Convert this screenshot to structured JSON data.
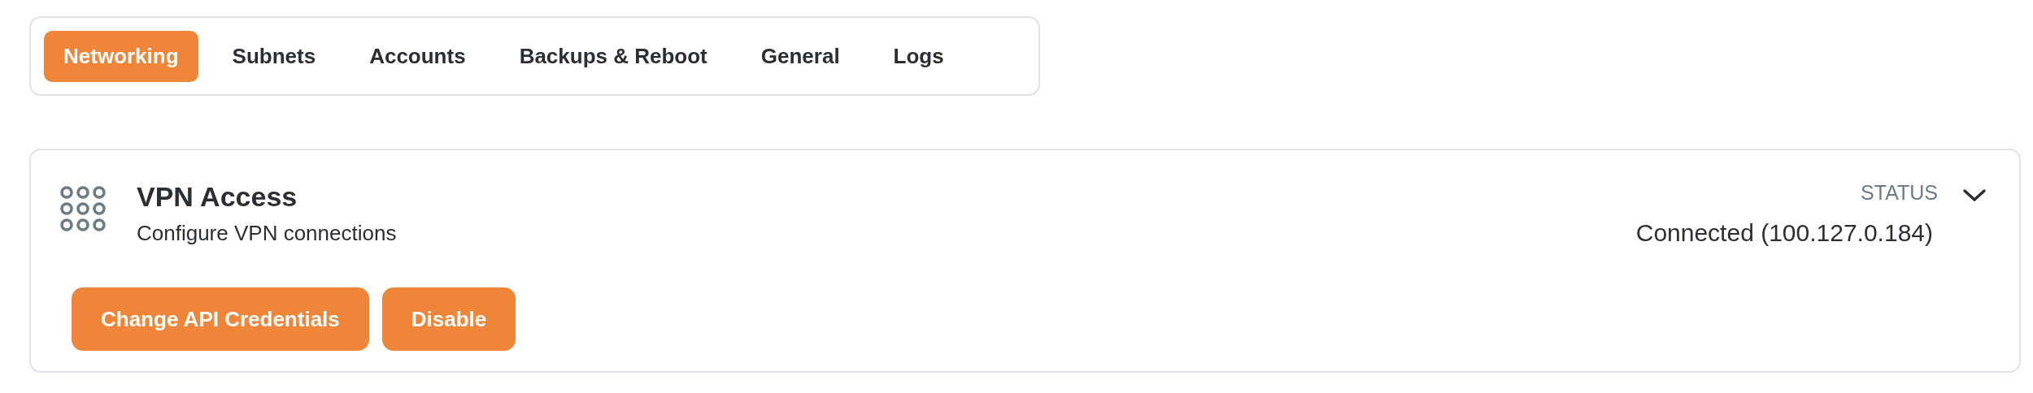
{
  "tabs": [
    {
      "label": "Networking",
      "selected": true
    },
    {
      "label": "Subnets",
      "selected": false
    },
    {
      "label": "Accounts",
      "selected": false
    },
    {
      "label": "Backups & Reboot",
      "selected": false
    },
    {
      "label": "General",
      "selected": false
    },
    {
      "label": "Logs",
      "selected": false
    }
  ],
  "card": {
    "title": "VPN Access",
    "subtitle": "Configure VPN connections",
    "status_label": "STATUS",
    "status_value": "Connected (100.127.0.184)",
    "buttons": [
      "Change API Credentials",
      "Disable"
    ]
  }
}
